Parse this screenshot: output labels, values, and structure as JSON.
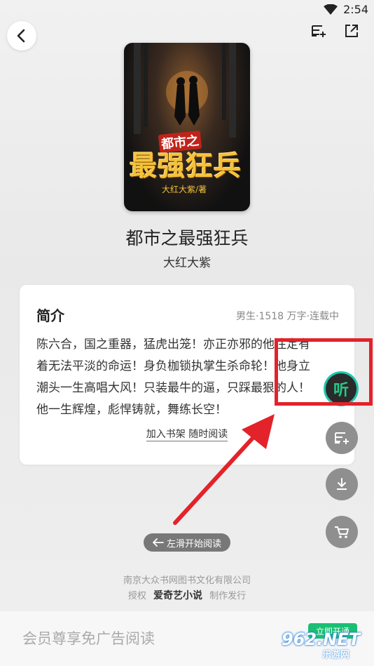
{
  "status_bar": {
    "time": "2:54"
  },
  "book": {
    "title": "都市之最强狂兵",
    "author": "大红大紫",
    "cover": {
      "title_top": "都市之",
      "title_main": "最强狂兵",
      "author_line": "大红大紫/著"
    }
  },
  "intro": {
    "heading": "简介",
    "meta": "男生·1518 万字·连载中",
    "lines": [
      "陈六合，国之重器，猛虎出笼！亦正亦邪的他注定有",
      "着无法平淡的命运！身负枷锁执掌生杀命轮！他身立",
      "潮头一生高唱大风！只装最牛的逼，只踩最狠的人！",
      "他一生辉煌，彪悍铸就，舞练长空！"
    ],
    "action": "加入书架 随时阅读"
  },
  "fab": {
    "listen_label": "听"
  },
  "swipe_hint": "左滑开始阅读",
  "footer": {
    "publisher": "南京大众书网图书文化有限公司",
    "license_prefix": "授权",
    "license_brand": "爱奇艺小说",
    "license_suffix": "制作发行"
  },
  "vip": {
    "text": "会员尊享免广告阅读",
    "button": "立即开通"
  },
  "watermark": {
    "main": "962.NET",
    "sub": "乐游网"
  },
  "colors": {
    "accent_green": "#1bbf74",
    "annotation_red": "#e3222a",
    "listen_ring": "#1fc7b0"
  }
}
